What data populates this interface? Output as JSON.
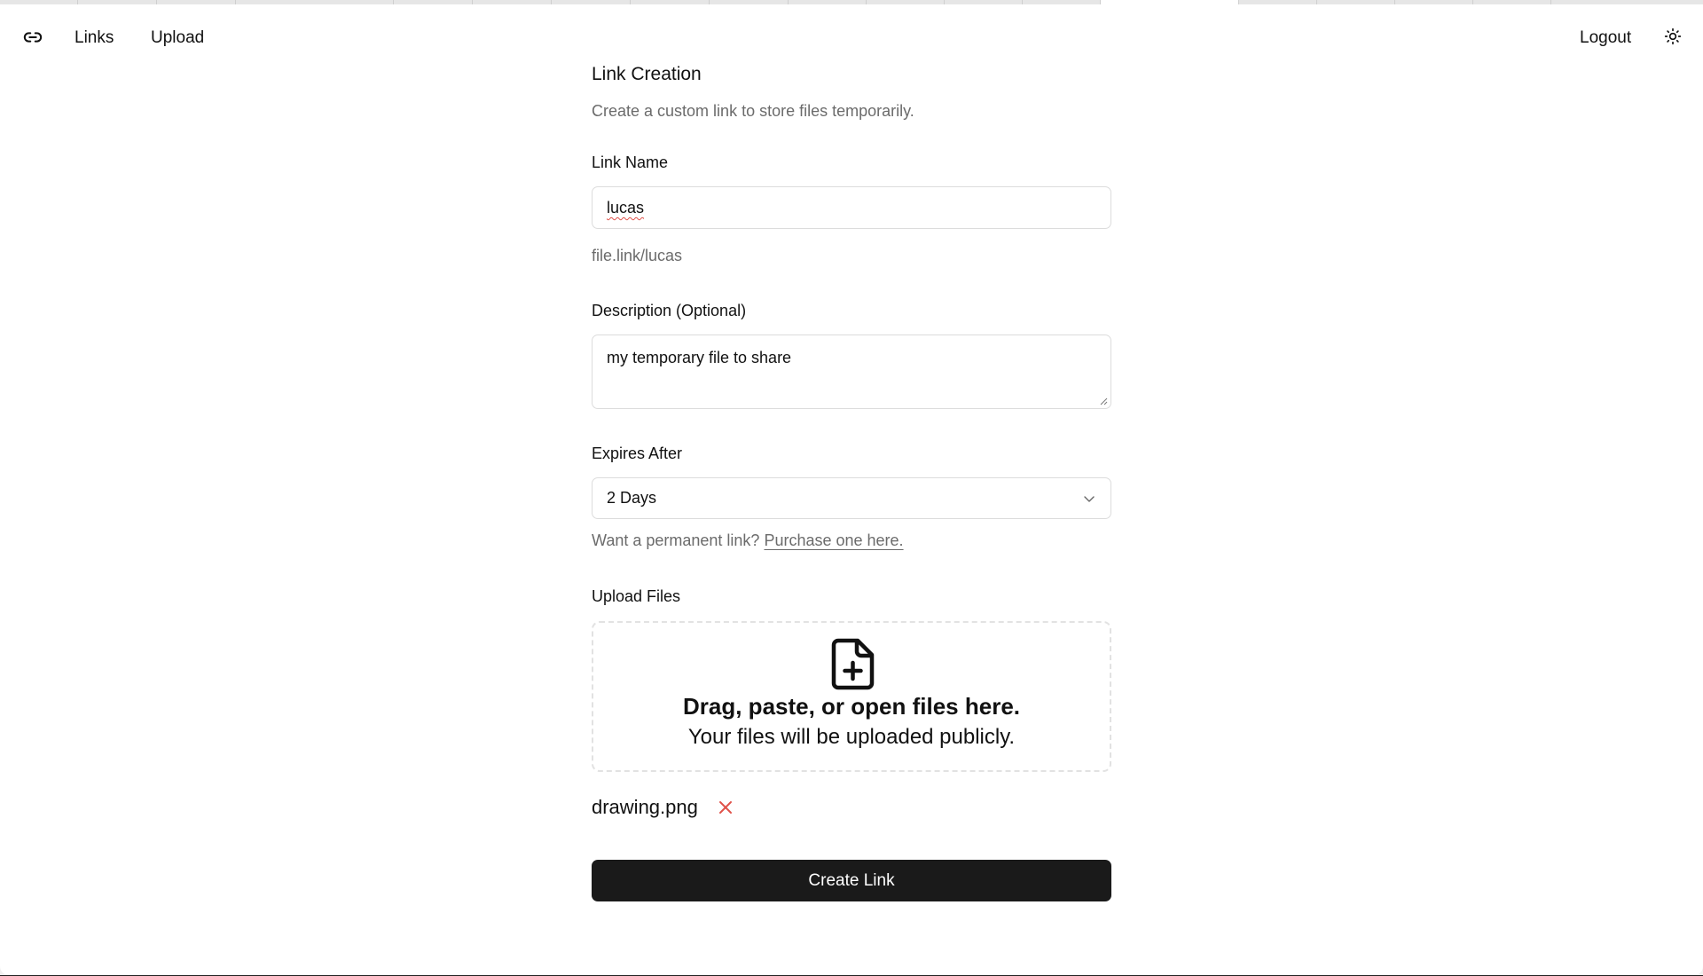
{
  "nav": {
    "logo_icon": "link-icon",
    "links_label": "Links",
    "upload_label": "Upload",
    "logout_label": "Logout",
    "theme_icon": "sun-icon"
  },
  "form": {
    "title": "Link Creation",
    "subtitle": "Create a custom link to store files temporarily.",
    "link_name": {
      "label": "Link Name",
      "value": "lucas",
      "preview": "file.link/lucas"
    },
    "description": {
      "label": "Description (Optional)",
      "value": "my temporary file to share"
    },
    "expires": {
      "label": "Expires After",
      "selected": "2 Days",
      "hint_text": "Want a permanent link?",
      "hint_link": "Purchase one here."
    },
    "upload": {
      "label": "Upload Files",
      "icon": "file-plus-icon",
      "drop_title": "Drag, paste, or open files here.",
      "drop_subtitle": "Your files will be uploaded publicly.",
      "files": [
        {
          "name": "drawing.png"
        }
      ]
    },
    "submit_label": "Create Link"
  },
  "colors": {
    "accent_button": "#1a1a1a",
    "muted_text": "#6b6b6b",
    "remove_icon": "#e0524a",
    "border": "#dcdcdc"
  }
}
